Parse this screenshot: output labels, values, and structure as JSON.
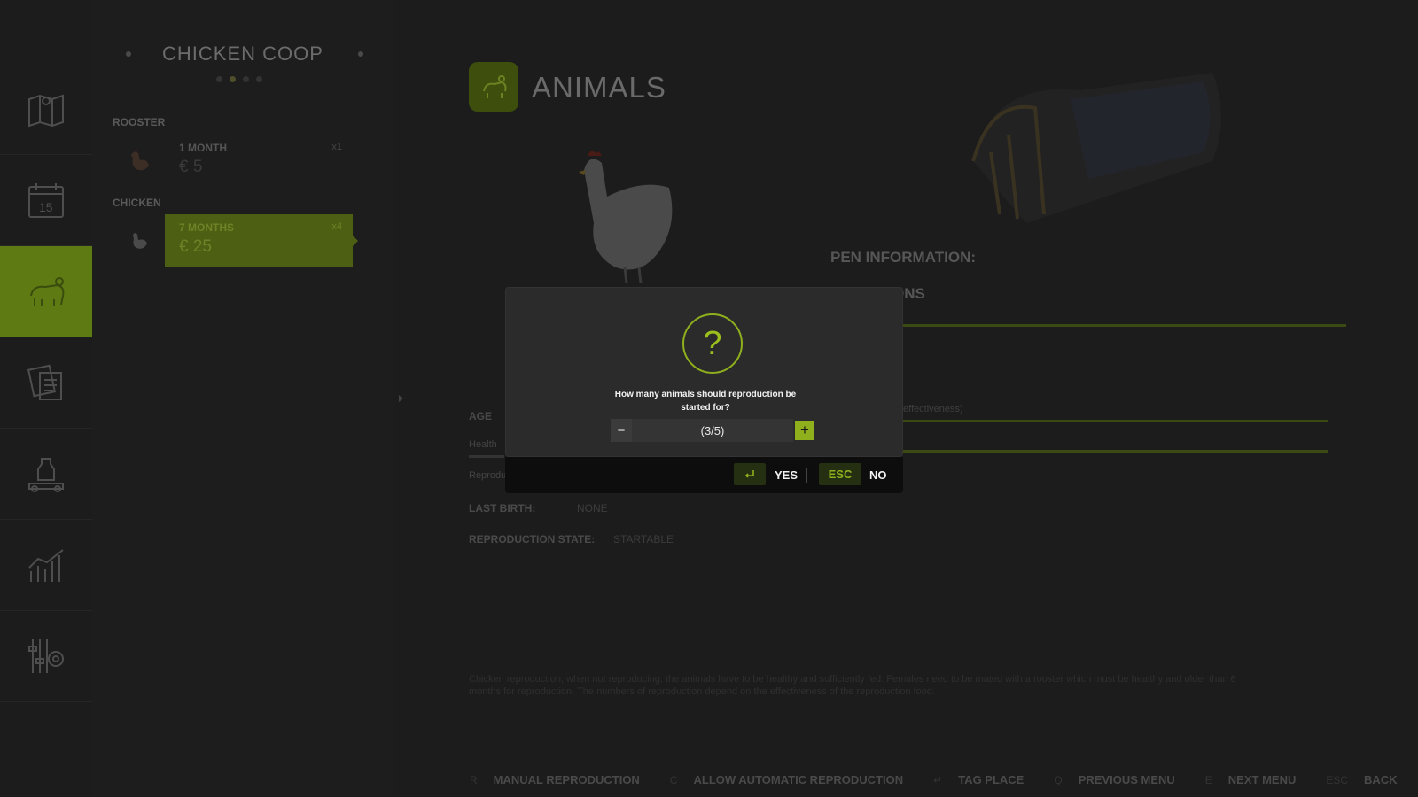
{
  "coop": {
    "title": "CHICKEN COOP"
  },
  "sections": {
    "rooster": "ROOSTER",
    "chicken": "CHICKEN"
  },
  "animals": [
    {
      "age": "1 MONTH",
      "price": "€ 5",
      "count": "x1"
    },
    {
      "age": "7 MONTHS",
      "price": "€ 25",
      "count": "x4"
    }
  ],
  "main": {
    "title": "ANIMALS",
    "pen_info": "PEN INFORMATION:",
    "conditions_partial": "ONS",
    "effectiveness_partial": "effectiveness)",
    "rows": [
      {
        "label": "AGE",
        "value": ""
      },
      {
        "label": "Health",
        "value": ""
      },
      {
        "label": "Reprodu",
        "value": ""
      }
    ],
    "last_birth": {
      "label": "LAST BIRTH:",
      "value": "NONE"
    },
    "repro_state": {
      "label": "REPRODUCTION STATE:",
      "value": "STARTABLE"
    },
    "description": "Chicken reproduction, when not reproducing, the animals have to be healthy and sufficiently fed. Females need to be mated with a rooster which must be healthy and older than 6 months for reproduction. The numbers of reproduction depend on the effectiveness of the reproduction food."
  },
  "modal": {
    "question": "How many animals should reproduction be started for?",
    "stepper_value": "(3/5)",
    "minus": "−",
    "plus": "+",
    "yes": "YES",
    "esc": "ESC",
    "no": "NO"
  },
  "bottom_hints": [
    {
      "key": "R",
      "label": "MANUAL REPRODUCTION"
    },
    {
      "key": "C",
      "label": "ALLOW AUTOMATIC REPRODUCTION"
    },
    {
      "key": "↵",
      "label": "TAG PLACE"
    },
    {
      "key": "Q",
      "label": "PREVIOUS MENU"
    },
    {
      "key": "E",
      "label": "NEXT MENU"
    },
    {
      "key": "ESC",
      "label": "BACK"
    }
  ],
  "colors": {
    "accent": "#8fb01c",
    "background": "#1c1c1c",
    "modal": "#2b2b2b"
  }
}
